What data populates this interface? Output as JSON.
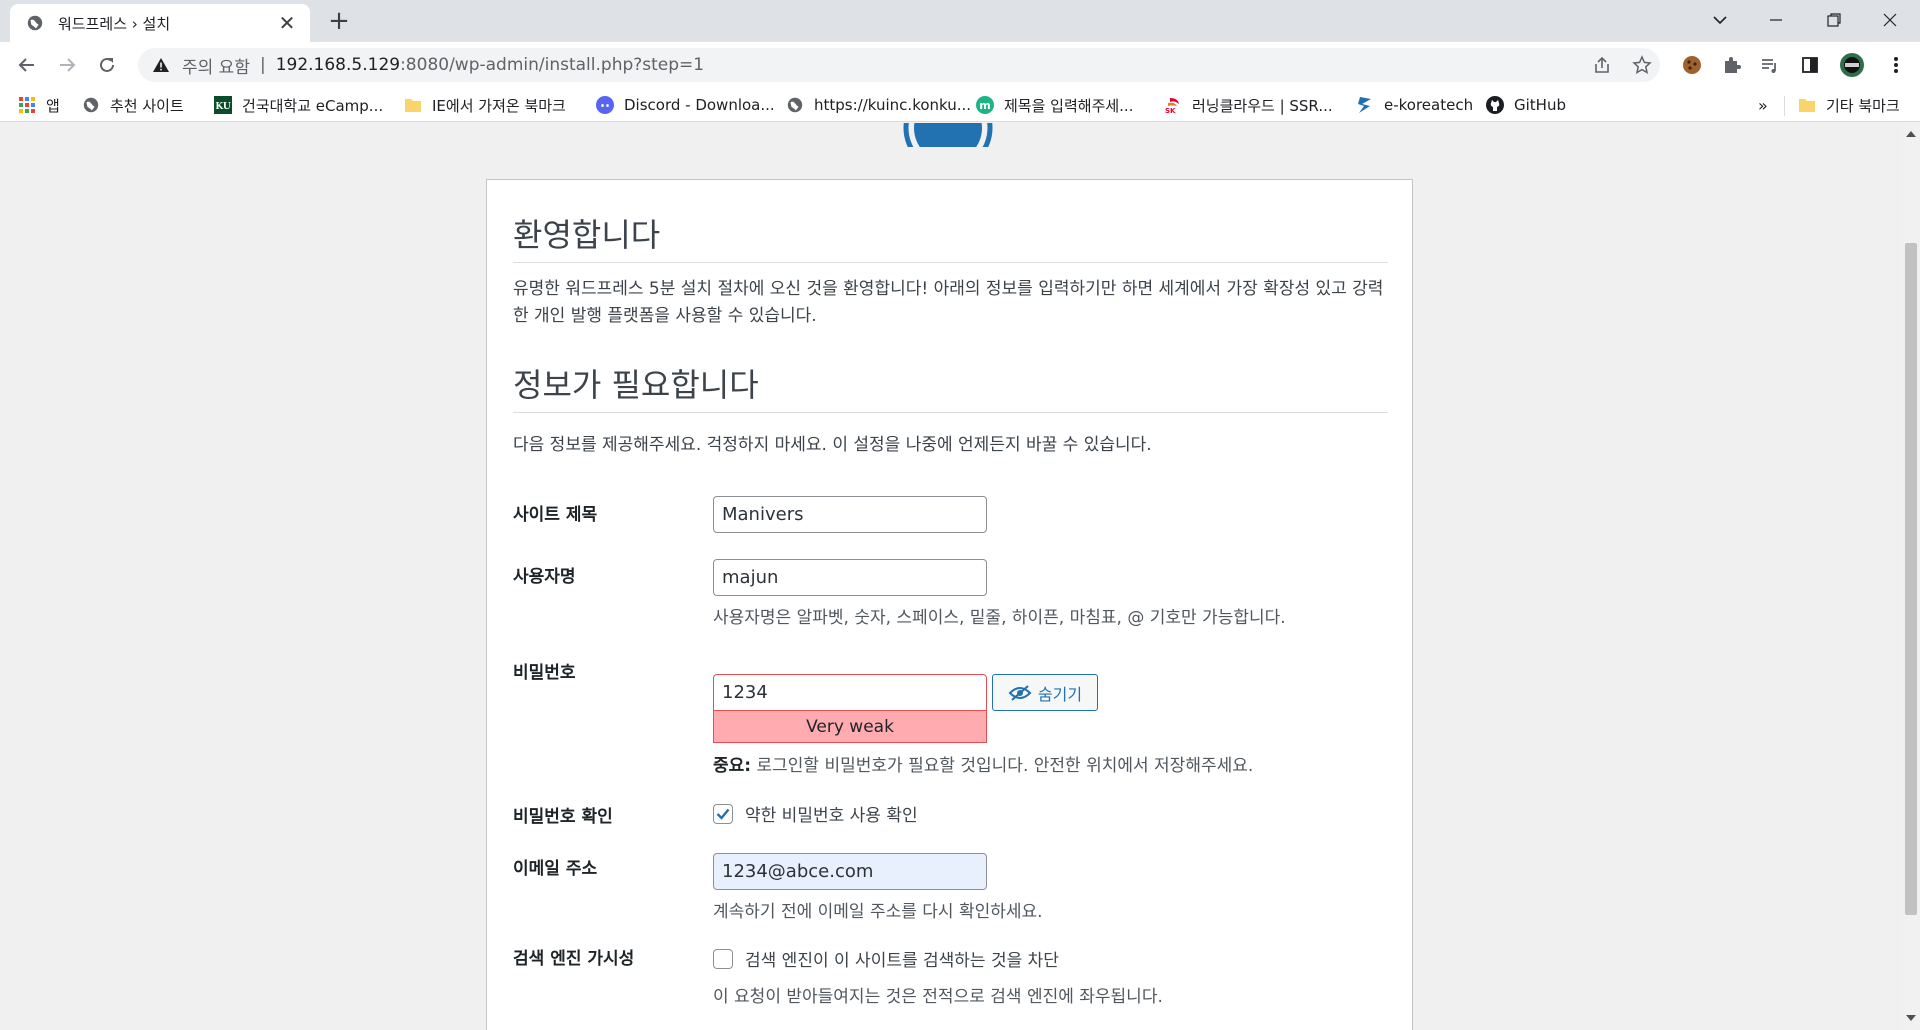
{
  "browser": {
    "tab_title": "워드프레스 › 설치",
    "url_security": "주의 요함",
    "url_separator": "|",
    "url_host": "192.168.5.129",
    "url_path": ":8080/wp-admin/install.php?step=1"
  },
  "bookmarks": {
    "items": [
      {
        "label": "앱",
        "icon": "apps-grid-icon"
      },
      {
        "label": "추천 사이트",
        "icon": "globe-icon"
      },
      {
        "label": "건국대학교 eCamp...",
        "icon": "ku-logo-icon"
      },
      {
        "label": "IE에서 가져온 북마크",
        "icon": "folder-icon"
      },
      {
        "label": "Discord - Downloa...",
        "icon": "discord-icon"
      },
      {
        "label": "https://kuinc.konku...",
        "icon": "globe-icon"
      },
      {
        "label": "제목을 입력해주세...",
        "icon": "m-logo-icon"
      },
      {
        "label": "러닝클라우드 | SSR...",
        "icon": "sk-logo-icon"
      },
      {
        "label": "e-koreatech",
        "icon": "koreatech-icon"
      },
      {
        "label": "GitHub",
        "icon": "github-icon"
      }
    ],
    "overflow": "»",
    "other_label": "기타 북마크"
  },
  "page": {
    "welcome_title": "환영합니다",
    "welcome_text": "유명한 워드프레스 5분 설치 절차에 오신 것을 환영합니다! 아래의 정보를 입력하기만 하면 세계에서 가장 확장성 있고 강력한 개인 발행 플랫폼을 사용할 수 있습니다.",
    "info_title": "정보가 필요합니다",
    "info_text": "다음 정보를 제공해주세요. 걱정하지 마세요. 이 설정을 나중에 언제든지 바꿀 수 있습니다.",
    "form": {
      "site_title_label": "사이트 제목",
      "site_title_value": "Manivers",
      "username_label": "사용자명",
      "username_value": "majun",
      "username_hint": "사용자명은 알파벳, 숫자, 스페이스, 밑줄, 하이픈, 마침표, @ 기호만 가능합니다.",
      "password_label": "비밀번호",
      "password_value": "1234",
      "password_strength": "Very weak",
      "hide_button": "숨기기",
      "password_important": "중요:",
      "password_hint": "로그인할 비밀번호가 필요할 것입니다. 안전한 위치에서 저장해주세요.",
      "confirm_label": "비밀번호 확인",
      "confirm_checkbox": "약한 비밀번호 사용 확인",
      "email_label": "이메일 주소",
      "email_value": "1234@abce.com",
      "email_hint": "계속하기 전에 이메일 주소를 다시 확인하세요.",
      "search_label": "검색 엔진 가시성",
      "search_checkbox": "검색 엔진이 이 사이트를 검색하는 것을 차단",
      "search_hint": "이 요청이 받아들여지는 것은 전적으로 검색 엔진에 좌우됩니다."
    }
  },
  "colors": {
    "wp_blue": "#2271b1",
    "weak_bg": "#ffabaf",
    "weak_border": "#e65054"
  }
}
